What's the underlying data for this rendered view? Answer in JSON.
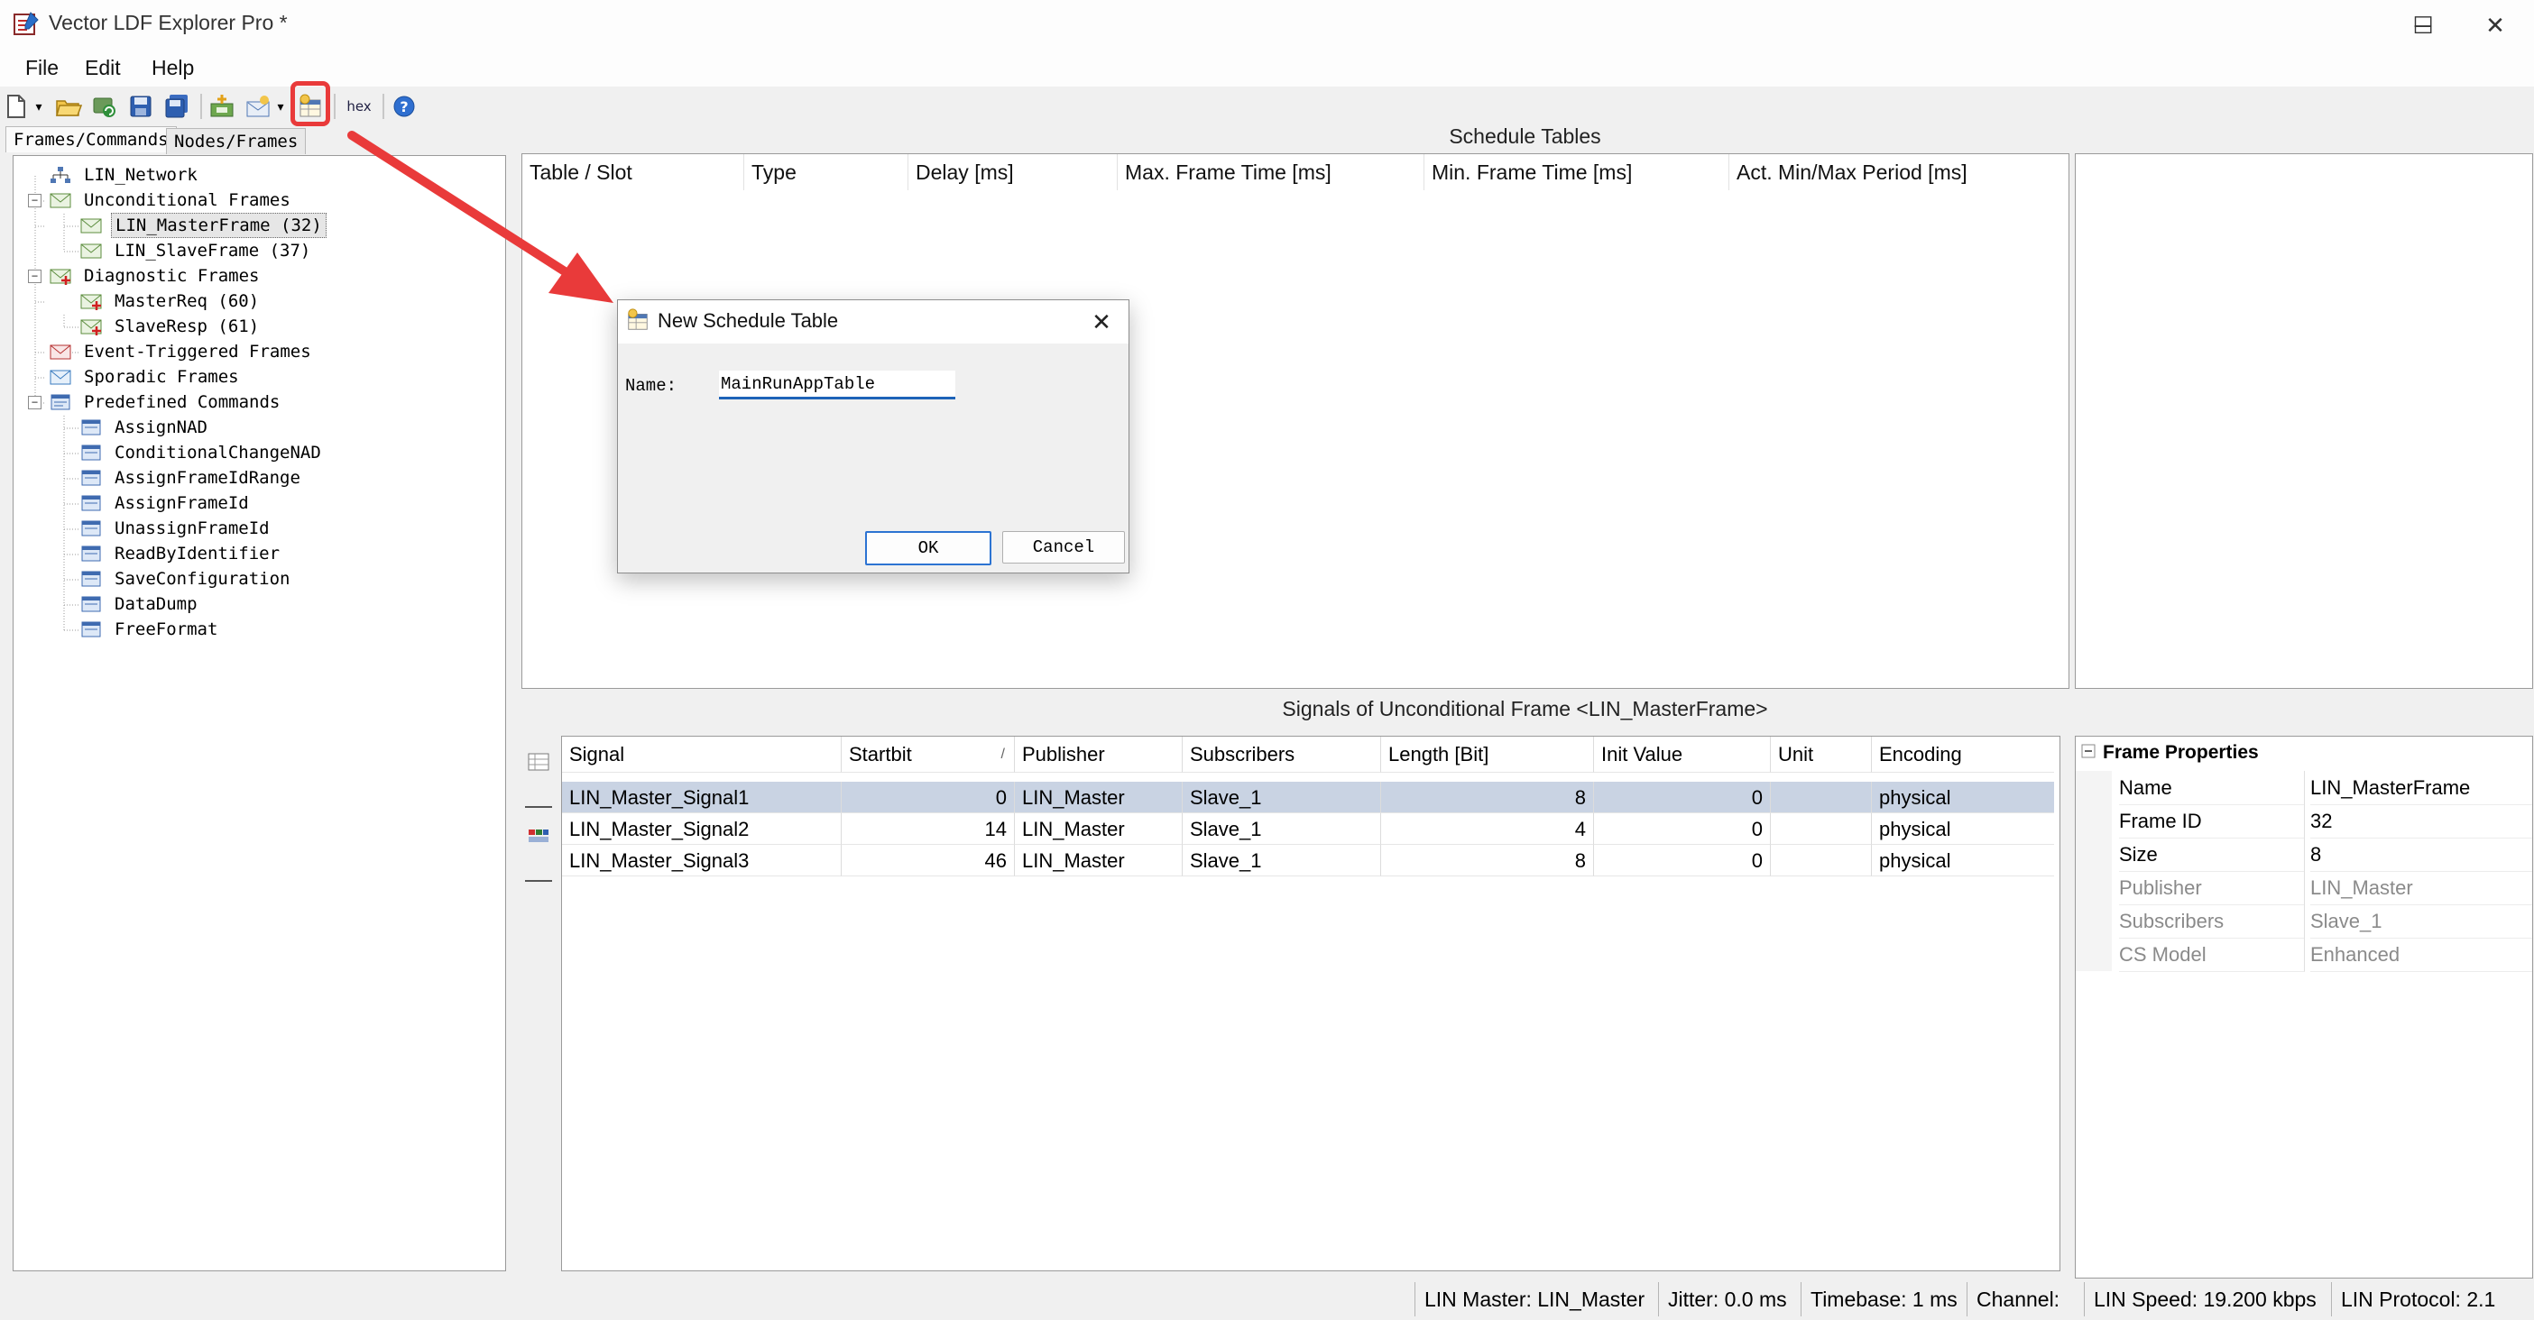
{
  "window": {
    "title": "Vector LDF Explorer Pro *",
    "controls": [
      "─",
      "☐",
      "✕"
    ]
  },
  "menu": {
    "items": [
      "File",
      "Edit",
      "Help"
    ]
  },
  "toolbar": {
    "hex_label": "hex",
    "icons": [
      "new-file-icon",
      "open-folder-icon",
      "reload-icon",
      "save-icon",
      "save-all-icon",
      "add-node-icon",
      "add-frame-icon",
      "new-schedule-table-icon",
      "hex-icon",
      "help-icon"
    ],
    "highlighted": "new-schedule-table-icon"
  },
  "left_panel": {
    "tabs": [
      "Frames/Commands",
      "Nodes/Frames"
    ],
    "tree": [
      {
        "label": "LIN_Network"
      },
      {
        "label": "Unconditional Frames"
      },
      {
        "label": "LIN_MasterFrame (32)",
        "selected": true
      },
      {
        "label": "LIN_SlaveFrame (37)"
      },
      {
        "label": "Diagnostic Frames"
      },
      {
        "label": "MasterReq (60)"
      },
      {
        "label": "SlaveResp (61)"
      },
      {
        "label": "Event-Triggered Frames"
      },
      {
        "label": "Sporadic Frames"
      },
      {
        "label": "Predefined Commands"
      },
      {
        "label": "AssignNAD"
      },
      {
        "label": "ConditionalChangeNAD"
      },
      {
        "label": "AssignFrameIdRange"
      },
      {
        "label": "AssignFrameId"
      },
      {
        "label": "UnassignFrameId"
      },
      {
        "label": "ReadByIdentifier"
      },
      {
        "label": "SaveConfiguration"
      },
      {
        "label": "DataDump"
      },
      {
        "label": "FreeFormat"
      }
    ]
  },
  "schedule": {
    "title": "Schedule Tables",
    "columns": [
      "Table / Slot",
      "Type",
      "Delay [ms]",
      "Max. Frame Time [ms]",
      "Min. Frame Time [ms]",
      "Act. Min/Max Period [ms]"
    ]
  },
  "signals": {
    "title": "Signals of Unconditional Frame <LIN_MasterFrame>",
    "columns": [
      "Signal",
      "Startbit",
      "Publisher",
      "Subscribers",
      "Length [Bit]",
      "Init Value",
      "Unit",
      "Encoding"
    ],
    "sort_indicator": "/",
    "rows": [
      [
        "LIN_Master_Signal1",
        "0",
        "LIN_Master",
        "Slave_1",
        "8",
        "0",
        "",
        "physical"
      ],
      [
        "LIN_Master_Signal2",
        "14",
        "LIN_Master",
        "Slave_1",
        "4",
        "0",
        "",
        "physical"
      ],
      [
        "LIN_Master_Signal3",
        "46",
        "LIN_Master",
        "Slave_1",
        "8",
        "0",
        "",
        "physical"
      ]
    ]
  },
  "properties": {
    "section": "Frame Properties",
    "items": [
      {
        "key": "Name",
        "value": "LIN_MasterFrame",
        "readonly": false
      },
      {
        "key": "Frame ID",
        "value": "32",
        "readonly": false
      },
      {
        "key": "Size",
        "value": "8",
        "readonly": false
      },
      {
        "key": "Publisher",
        "value": "LIN_Master",
        "readonly": true
      },
      {
        "key": "Subscribers",
        "value": "Slave_1",
        "readonly": true
      },
      {
        "key": "CS Model",
        "value": "Enhanced",
        "readonly": true
      }
    ]
  },
  "dialog": {
    "title": "New Schedule Table",
    "name_label": "Name:",
    "name_value": "MainRunAppTable",
    "ok": "OK",
    "cancel": "Cancel"
  },
  "statusbar": {
    "lin_master": "LIN Master: LIN_Master",
    "jitter": "Jitter: 0.0 ms",
    "timebase": "Timebase: 1 ms",
    "channel": "Channel:",
    "speed": "LIN Speed: 19.200 kbps",
    "protocol": "LIN Protocol: 2.1"
  },
  "colors": {
    "accent": "#2c73d2",
    "highlight": "#e93a3a",
    "selection": "#c9d3e3"
  }
}
